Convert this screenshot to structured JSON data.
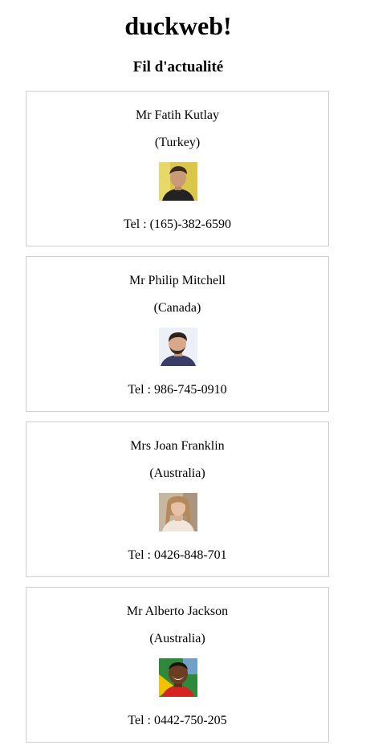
{
  "site": {
    "title": "duckweb!"
  },
  "feed": {
    "title": "Fil d'actualité",
    "people": [
      {
        "name": "Mr Fatih Kutlay",
        "country": "(Turkey)",
        "tel": "Tel : (165)-382-6590",
        "avatar_icon": "male-portrait-icon",
        "colors": {
          "bg": "#d9c64a",
          "skin": "#c99a77",
          "hair": "#3b2a20",
          "shirt": "#222222"
        }
      },
      {
        "name": "Mr Philip Mitchell",
        "country": "(Canada)",
        "tel": "Tel : 986-745-0910",
        "avatar_icon": "male-portrait-icon",
        "colors": {
          "bg": "#eef0f8",
          "skin": "#d6a98a",
          "hair": "#2c211b",
          "shirt": "#3a3d66"
        }
      },
      {
        "name": "Mrs Joan Franklin",
        "country": "(Australia)",
        "tel": "Tel : 0426-848-701",
        "avatar_icon": "female-portrait-icon",
        "colors": {
          "bg": "#c7b6a0",
          "skin": "#e7c1a5",
          "hair": "#b58a5a",
          "shirt": "#efe7dc"
        }
      },
      {
        "name": "Mr Alberto Jackson",
        "country": "(Australia)",
        "tel": "Tel : 0442-750-205",
        "avatar_icon": "male-portrait-icon",
        "colors": {
          "bg": "#2e8a3a",
          "skin": "#6b3d22",
          "hair": "#1b120c",
          "shirt": "#d42525"
        }
      }
    ]
  }
}
